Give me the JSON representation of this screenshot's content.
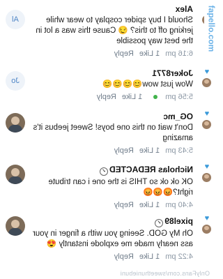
{
  "watermark": "fapello.com",
  "footer": "OnlyFans.com/sweethuniebuni",
  "comments": [
    {
      "initials": "Al",
      "name": "Alex",
      "verified": false,
      "text": "Should I buy spider cosplay to wear while jerking off to this? 😏 Cause this was a lot in the best way possible",
      "time": "6:16 pm",
      "likes": "1 Like",
      "reply": "Reply"
    },
    {
      "initials": "Jo",
      "name": "Joker8771",
      "verified": false,
      "text": "Wow just wow😊😊😊😊",
      "time": "5:56 pm",
      "likes": "1 Like",
      "reply": "Reply"
    },
    {
      "initials": "",
      "name": "OG_mc",
      "verified": false,
      "text": "Don't wait on this one boys! Sweet jeebus it's amazing",
      "time": "5:43 pm",
      "likes": "1 Like",
      "reply": "Reply"
    },
    {
      "initials": "",
      "name": "Nicholas REDACTED",
      "verified": true,
      "text": "OK ok ok so THIS is the one i can tribute right?😡😡😡",
      "time": "4:40 pm",
      "likes": "1 Like",
      "reply": "Reply"
    },
    {
      "initials": "",
      "name": "pixel89",
      "verified": true,
      "text": "Oh My GOD. Seeing you with a finger in your ass nearly made me explode instantly 😍",
      "time": "4:22 pm",
      "likes": "1 Like",
      "reply": "Reply"
    }
  ]
}
